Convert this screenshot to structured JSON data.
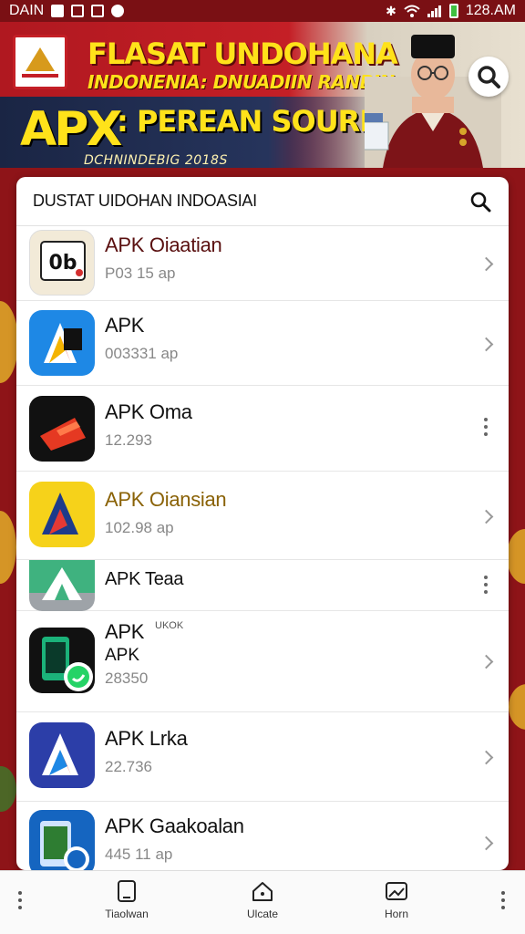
{
  "status_bar": {
    "left_text": "DAIN",
    "time": "128.AM"
  },
  "banner": {
    "line1": "FLASAT UNDOHANA",
    "line2": "INDONENIA: DNUADIIN RANBIN",
    "apk_mark": "APX",
    "line3": ": PEREAN SOURIAS",
    "line4": "DCHNINDEBIG 2018S",
    "logo_icon": "triangle-emblem-icon",
    "search_icon": "search-icon"
  },
  "list": {
    "title": "DUSTAT UIDOHAN INDOASIAI",
    "search_icon": "search-icon",
    "items": [
      {
        "name": "APK Oiaatian",
        "sub": "P03 15 ap",
        "action": "chevron",
        "name_color": "#7a1a1a"
      },
      {
        "name": "APK",
        "sub": "003331 ap",
        "action": "chevron",
        "name_color": "#111111"
      },
      {
        "name": "APK Oma",
        "sub": "12.293",
        "action": "more",
        "name_color": "#111111"
      },
      {
        "name": "APK Oiansian",
        "sub": "102.98 ap",
        "action": "chevron",
        "name_color": "#a07010"
      },
      {
        "name": "APK Teaa",
        "sub": "",
        "action": "more",
        "name_color": "#111111"
      },
      {
        "name": "APK",
        "name2": "APK",
        "badge": "UKOK",
        "sub": "28350",
        "action": "chevron",
        "name_color": "#111111"
      },
      {
        "name": "APK Lrka",
        "sub": "22.736",
        "action": "chevron",
        "name_color": "#111111"
      },
      {
        "name": "APK Gaakoalan",
        "sub": "445 11 ap",
        "action": "chevron",
        "name_color": "#111111"
      }
    ]
  },
  "bottom_nav": {
    "items": [
      {
        "label": "Tiaolwan",
        "icon": "tablet-icon"
      },
      {
        "label": "Ulcate",
        "icon": "home-icon"
      },
      {
        "label": "Horn",
        "icon": "gallery-icon"
      }
    ]
  },
  "colors": {
    "background": "#8e1418",
    "banner_yellow": "#ffe21a",
    "card": "#ffffff"
  }
}
